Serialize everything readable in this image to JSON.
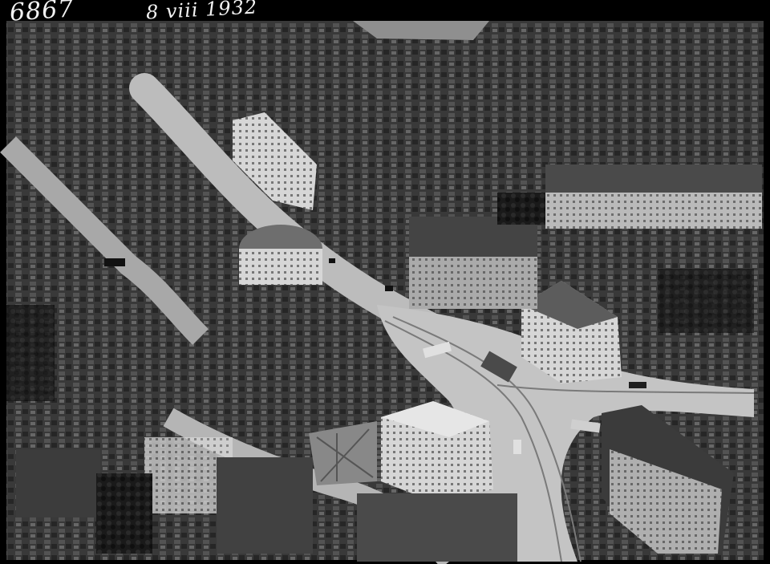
{
  "photo": {
    "kind": "black-and-white aerial photograph",
    "subject": "city junction with apartment blocks, tram island and curved streets"
  },
  "annotations": {
    "plate_number": "6867",
    "date_note": "8 viii 1932"
  },
  "colors": {
    "border": "#000000",
    "roof_dark": "#2e2e2e",
    "roof_mid": "#5a5a5a",
    "facade_light": "#d9d9d9",
    "street": "#bdbdbd",
    "foliage": "#151515"
  }
}
